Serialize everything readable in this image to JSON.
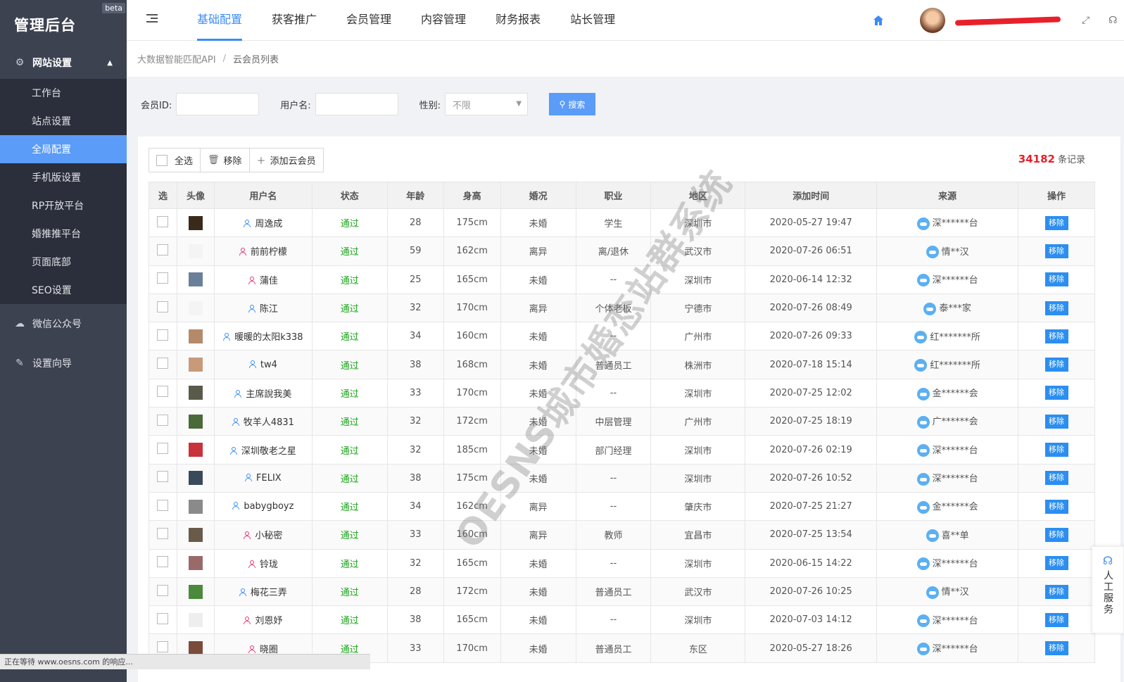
{
  "brand": {
    "title": "管理后台",
    "badge": "beta"
  },
  "sidebar": {
    "group": {
      "label": "网站设置"
    },
    "items": [
      {
        "label": "工作台",
        "active": false
      },
      {
        "label": "站点设置",
        "active": false
      },
      {
        "label": "全局配置",
        "active": true
      },
      {
        "label": "手机版设置",
        "active": false
      },
      {
        "label": "RP开放平台",
        "active": false
      },
      {
        "label": "婚推推平台",
        "active": false
      },
      {
        "label": "页面底部",
        "active": false
      },
      {
        "label": "SEO设置",
        "active": false
      }
    ],
    "plain": [
      {
        "label": "微信公众号",
        "icon": "wechat-icon"
      },
      {
        "label": "设置向导",
        "icon": "edit-icon"
      }
    ]
  },
  "topnav": {
    "items": [
      "基础配置",
      "获客推广",
      "会员管理",
      "内容管理",
      "财务报表",
      "站长管理"
    ],
    "active": 0
  },
  "breadcrumb": {
    "parent": "大数据智能匹配API",
    "current": "云会员列表"
  },
  "filter": {
    "member_id_label": "会员ID:",
    "username_label": "用户名:",
    "gender_label": "性别:",
    "gender_value": "不限",
    "search_label": "搜索"
  },
  "toolbar": {
    "select_all": "全选",
    "remove": "移除",
    "add": "添加云会员"
  },
  "records": {
    "count": "34182",
    "suffix": "条记录"
  },
  "table": {
    "headers": [
      "选",
      "头像",
      "用户名",
      "状态",
      "年龄",
      "身高",
      "婚况",
      "职业",
      "地区",
      "添加时间",
      "来源",
      "操作"
    ],
    "action_label": "移除",
    "rows": [
      {
        "gender": "m",
        "name": "周逸成",
        "status": "通过",
        "age": "28",
        "height": "175cm",
        "marital": "未婚",
        "job": "学生",
        "region": "深圳市",
        "time": "2020-05-27 19:47",
        "source": "深******台",
        "thumb": "#3a2a1a"
      },
      {
        "gender": "f",
        "name": "前前柠檬",
        "status": "通过",
        "age": "59",
        "height": "162cm",
        "marital": "离异",
        "job": "离/退休",
        "region": "武汉市",
        "time": "2020-07-26 06:51",
        "source": "情**汉",
        "thumb": "#f4f4f4"
      },
      {
        "gender": "f",
        "name": "蒲佳",
        "status": "通过",
        "age": "25",
        "height": "165cm",
        "marital": "未婚",
        "job": "--",
        "region": "深圳市",
        "time": "2020-06-14 12:32",
        "source": "深******台",
        "thumb": "#6a7f9a"
      },
      {
        "gender": "m",
        "name": "陈江",
        "status": "通过",
        "age": "32",
        "height": "170cm",
        "marital": "离异",
        "job": "个体老板",
        "region": "宁德市",
        "time": "2020-07-26 08:49",
        "source": "泰***家",
        "thumb": "#f4f4f4"
      },
      {
        "gender": "m",
        "name": "暖暖的太阳k338",
        "status": "通过",
        "age": "34",
        "height": "160cm",
        "marital": "未婚",
        "job": "--",
        "region": "广州市",
        "time": "2020-07-26 09:33",
        "source": "红*******所",
        "thumb": "#b58a6a"
      },
      {
        "gender": "m",
        "name": "tw4",
        "status": "通过",
        "age": "38",
        "height": "168cm",
        "marital": "未婚",
        "job": "普通员工",
        "region": "株洲市",
        "time": "2020-07-18 15:14",
        "source": "红*******所",
        "thumb": "#c99a7a"
      },
      {
        "gender": "m",
        "name": "主席說我美",
        "status": "通过",
        "age": "33",
        "height": "170cm",
        "marital": "未婚",
        "job": "--",
        "region": "深圳市",
        "time": "2020-07-25 12:02",
        "source": "金******会",
        "thumb": "#5a5a4a"
      },
      {
        "gender": "m",
        "name": "牧羊人4831",
        "status": "通过",
        "age": "32",
        "height": "172cm",
        "marital": "未婚",
        "job": "中层管理",
        "region": "广州市",
        "time": "2020-07-25 18:19",
        "source": "广******会",
        "thumb": "#4a6a3a"
      },
      {
        "gender": "m",
        "name": "深圳敬老之星",
        "status": "通过",
        "age": "32",
        "height": "185cm",
        "marital": "未婚",
        "job": "部门经理",
        "region": "深圳市",
        "time": "2020-07-26 02:19",
        "source": "深******台",
        "thumb": "#c8323a"
      },
      {
        "gender": "m",
        "name": "FELIX",
        "status": "通过",
        "age": "38",
        "height": "175cm",
        "marital": "未婚",
        "job": "--",
        "region": "深圳市",
        "time": "2020-07-26 10:52",
        "source": "深******台",
        "thumb": "#3a4a5a"
      },
      {
        "gender": "m",
        "name": "babygboyz",
        "status": "通过",
        "age": "34",
        "height": "162cm",
        "marital": "离异",
        "job": "--",
        "region": "肇庆市",
        "time": "2020-07-25 21:27",
        "source": "金******会",
        "thumb": "#8a8a8a"
      },
      {
        "gender": "f",
        "name": "小秘密",
        "status": "通过",
        "age": "33",
        "height": "160cm",
        "marital": "离异",
        "job": "教师",
        "region": "宜昌市",
        "time": "2020-07-25 13:54",
        "source": "喜**单",
        "thumb": "#6a5a4a"
      },
      {
        "gender": "f",
        "name": "铃珑",
        "status": "通过",
        "age": "32",
        "height": "165cm",
        "marital": "未婚",
        "job": "--",
        "region": "深圳市",
        "time": "2020-06-15 14:22",
        "source": "深******台",
        "thumb": "#9a6a6a"
      },
      {
        "gender": "m",
        "name": "梅花三弄",
        "status": "通过",
        "age": "28",
        "height": "172cm",
        "marital": "未婚",
        "job": "普通员工",
        "region": "武汉市",
        "time": "2020-07-26 10:25",
        "source": "情**汉",
        "thumb": "#4a8a3a"
      },
      {
        "gender": "f",
        "name": "刘恩妤",
        "status": "通过",
        "age": "38",
        "height": "165cm",
        "marital": "未婚",
        "job": "--",
        "region": "深圳市",
        "time": "2020-07-03 14:12",
        "source": "深******台",
        "thumb": "#eeeeee"
      },
      {
        "gender": "f",
        "name": "晓圈",
        "status": "通过",
        "age": "33",
        "height": "170cm",
        "marital": "未婚",
        "job": "普通员工",
        "region": "东区",
        "time": "2020-05-27 18:26",
        "source": "深******台",
        "thumb": "#7a4a3a"
      }
    ]
  },
  "watermark": "OESNS城市婚恋站群系统",
  "service": {
    "label": "人工服务"
  },
  "statusbar": "正在等待 www.oesns.com 的响应..."
}
